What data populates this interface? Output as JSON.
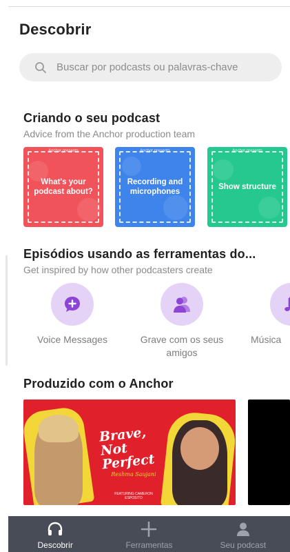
{
  "header": {
    "title": "Descobrir"
  },
  "search": {
    "placeholder": "Buscar por podcasts ou palavras-chave",
    "icon": "search-icon"
  },
  "create_section": {
    "title": "Criando o seu podcast",
    "subtitle": "Advice from the Anchor production team",
    "cards": [
      {
        "presents": "Anchor presents",
        "label": "What's your podcast about?",
        "color": "#f0545a"
      },
      {
        "presents": "Anchor presents",
        "label": "Recording and microphones",
        "color": "#3e84ea"
      },
      {
        "presents": "Anchor presents",
        "label": "Show structure",
        "color": "#25c98f"
      }
    ]
  },
  "tools_section": {
    "title": "Episódios usando as ferramentas do...",
    "subtitle": "Get inspired by how other podcasters create",
    "items": [
      {
        "label": "Voice Messages",
        "icon": "chat-plus-icon"
      },
      {
        "label": "Grave com os seus amigos",
        "icon": "friends-icon"
      },
      {
        "label": "Música",
        "icon": "music-note-icon"
      }
    ]
  },
  "produced_section": {
    "title": "Produzido com o Anchor",
    "banner": {
      "title": "Brave, Not Perfect",
      "signature": "Reshma Saujani",
      "featuring": "FEATURING CAMERON ESPOSITO"
    }
  },
  "tabbar": {
    "tabs": [
      {
        "label": "Descobrir",
        "icon": "headphones-icon",
        "active": true
      },
      {
        "label": "Ferramentas",
        "icon": "plus-icon",
        "active": false
      },
      {
        "label": "Seu podcast",
        "icon": "person-icon",
        "active": false
      }
    ]
  },
  "colors": {
    "accent_purple": "#8e44d6",
    "bubble_lavender": "#e4d3f7",
    "tabbar_bg": "#474c57"
  }
}
